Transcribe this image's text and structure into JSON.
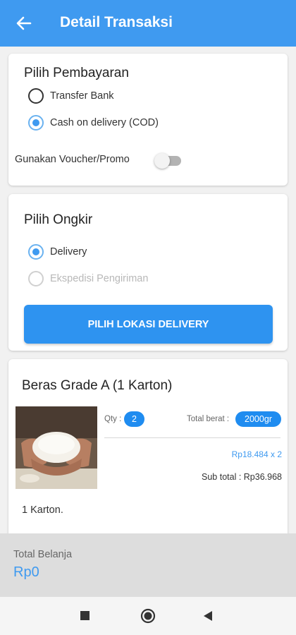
{
  "header": {
    "title": "Detail Transaksi",
    "back_icon": "arrow-left-icon",
    "background": "#3f9af0"
  },
  "payment": {
    "title": "Pilih Pembayaran",
    "options": [
      {
        "label": "Transfer Bank",
        "selected": false
      },
      {
        "label": "Cash on delivery (COD)",
        "selected": true
      }
    ],
    "voucher_label": "Gunakan Voucher/Promo",
    "voucher_enabled": false
  },
  "shipping": {
    "title": "Pilih Ongkir",
    "options": [
      {
        "label": "Delivery",
        "selected": true,
        "disabled": false
      },
      {
        "label": "Ekspedisi Pengiriman",
        "selected": false,
        "disabled": true
      }
    ],
    "button_label": "PILIH LOKASI DELIVERY"
  },
  "product": {
    "name": "Beras Grade A (1 Karton)",
    "qty_label": "Qty :",
    "qty": "2",
    "weight_label": "Total berat :",
    "weight": "2000gr",
    "price_line": "Rp18.484 x 2",
    "subtotal": "Sub total : Rp36.968",
    "unit": "1 Karton."
  },
  "summary": {
    "total_label": "Total Belanja",
    "total_value": "Rp0"
  },
  "navbar": {
    "icons": [
      "recent-apps-icon",
      "home-icon",
      "back-icon"
    ]
  },
  "colors": {
    "accent": "#3f9af0",
    "button": "#2e93f0",
    "pill": "#1f8cf0"
  }
}
